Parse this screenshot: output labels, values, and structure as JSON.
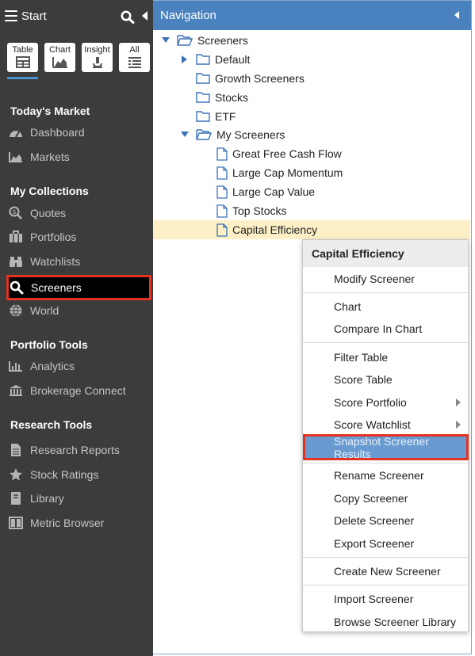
{
  "sidebar": {
    "start_label": "Start",
    "view_buttons": [
      {
        "label": "Table",
        "icon": "table-icon"
      },
      {
        "label": "Chart",
        "icon": "chart-icon"
      },
      {
        "label": "Insight",
        "icon": "microscope-icon"
      },
      {
        "label": "All",
        "icon": "list-icon"
      }
    ],
    "sections": {
      "todays_market": "Today's Market",
      "my_collections": "My Collections",
      "portfolio_tools": "Portfolio Tools",
      "research_tools": "Research Tools"
    },
    "items": {
      "dashboard": "Dashboard",
      "markets": "Markets",
      "quotes": "Quotes",
      "portfolios": "Portfolios",
      "watchlists": "Watchlists",
      "screeners": "Screeners",
      "world": "World",
      "analytics": "Analytics",
      "brokerage_connect": "Brokerage Connect",
      "research_reports": "Research Reports",
      "stock_ratings": "Stock Ratings",
      "library": "Library",
      "metric_browser": "Metric Browser"
    }
  },
  "nav": {
    "title": "Navigation",
    "tree": {
      "root": "Screeners",
      "default": "Default",
      "growth": "Growth Screeners",
      "stocks": "Stocks",
      "etf": "ETF",
      "my_screeners": "My Screeners",
      "great_free_cash_flow": "Great Free Cash Flow",
      "large_cap_momentum": "Large Cap Momentum",
      "large_cap_value": "Large Cap Value",
      "top_stocks": "Top Stocks",
      "capital_efficiency": "Capital Efficiency"
    }
  },
  "context_menu": {
    "title": "Capital Efficiency",
    "modify": "Modify Screener",
    "chart": "Chart",
    "compare_in_chart": "Compare In Chart",
    "filter_table": "Filter Table",
    "score_table": "Score Table",
    "score_portfolio": "Score Portfolio",
    "score_watchlist": "Score Watchlist",
    "snapshot": "Snapshot Screener Results",
    "rename": "Rename Screener",
    "copy": "Copy Screener",
    "delete": "Delete Screener",
    "export": "Export Screener",
    "create_new": "Create New Screener",
    "import": "Import Screener",
    "browse_library": "Browse Screener Library"
  },
  "colors": {
    "sidebar_bg": "#3c3c3c",
    "nav_header": "#4a82c0",
    "highlight_row": "#fdf0c7",
    "selection_border": "#e53222",
    "menu_active": "#6a9bd0"
  }
}
